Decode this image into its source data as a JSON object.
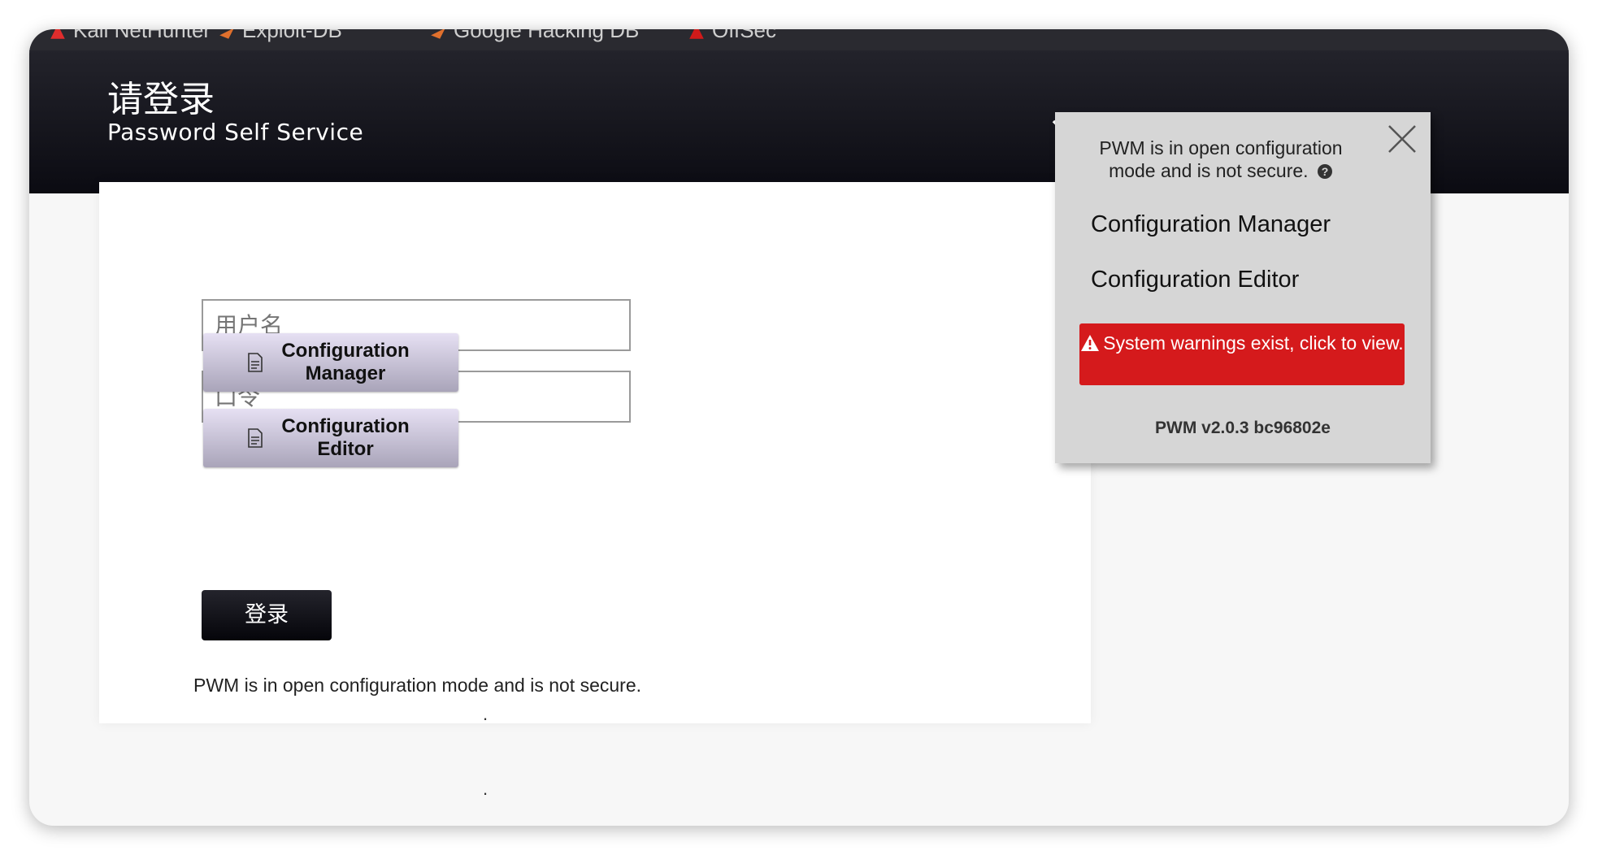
{
  "bookmarks": [
    {
      "label": "Kali NetHunter",
      "color": "#e02d2d"
    },
    {
      "label": "Exploit-DB",
      "color": "#e0702d"
    },
    {
      "label": "Google Hacking DB",
      "color": "#e0702d"
    },
    {
      "label": "OffSec",
      "color": "#d11a1a"
    }
  ],
  "header": {
    "title": "请登录",
    "subtitle": "Password Self Service",
    "menu_icon": "chevron-down-icon"
  },
  "login": {
    "username_placeholder": "用户名",
    "password_placeholder": "口令",
    "submit_label": "登录",
    "config_note": "PWM is in open configuration mode and is not secure.",
    "config_manager_label": "Configuration Manager",
    "config_editor_label": "Configuration Editor",
    "config_manager_suffix": ".",
    "config_editor_suffix": "."
  },
  "popup": {
    "message": "PWM is in open configuration mode and is not secure.",
    "help_icon": "question-circle-icon",
    "close_icon": "close-icon",
    "config_manager_link": "Configuration Manager",
    "config_editor_link": "Configuration Editor",
    "warning_text": "System warnings exist, click to view.",
    "warning_icon": "warning-triangle-icon",
    "version": "PWM v2.0.3 bc96802e"
  },
  "colors": {
    "header_bg": "#0b0b12",
    "warning_bg": "#d51a1c",
    "popup_bg": "#d6d6d6",
    "config_button_bg": "#c8c2da"
  }
}
